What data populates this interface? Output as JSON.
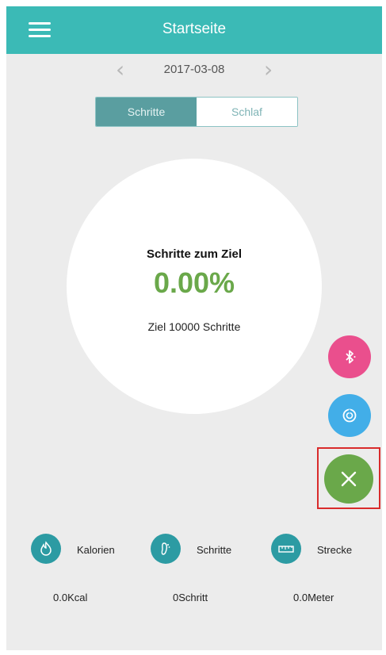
{
  "header": {
    "title": "Startseite",
    "menu_icon": "menu-icon"
  },
  "date_nav": {
    "date": "2017-03-08",
    "prev_icon": "chevron-left-icon",
    "next_icon": "chevron-right-icon"
  },
  "tabs": [
    {
      "label": "Schritte",
      "active": true
    },
    {
      "label": "Schlaf",
      "active": false
    }
  ],
  "goal": {
    "label": "Schritte zum Ziel",
    "value": "0.00%",
    "target": "Ziel 10000 Schritte",
    "progress": 0.0
  },
  "fab": {
    "bluetooth": {
      "icon": "bluetooth-icon",
      "color": "#ea4f8d"
    },
    "heart_rate": {
      "icon": "heart-rate-icon",
      "color": "#42aee8"
    },
    "close": {
      "icon": "close-icon",
      "color": "#6aa84a"
    }
  },
  "stats": [
    {
      "icon": "flame-icon",
      "label": "Kalorien",
      "value": "0.0Kcal"
    },
    {
      "icon": "footprint-icon",
      "label": "Schritte",
      "value": "0Schritt"
    },
    {
      "icon": "ruler-icon",
      "label": "Strecke",
      "value": "0.0Meter"
    }
  ],
  "colors": {
    "primary": "#3bbab6",
    "accent_green": "#6aa84a",
    "stat_icon": "#2c9ba3",
    "highlight": "#d92b2b"
  }
}
